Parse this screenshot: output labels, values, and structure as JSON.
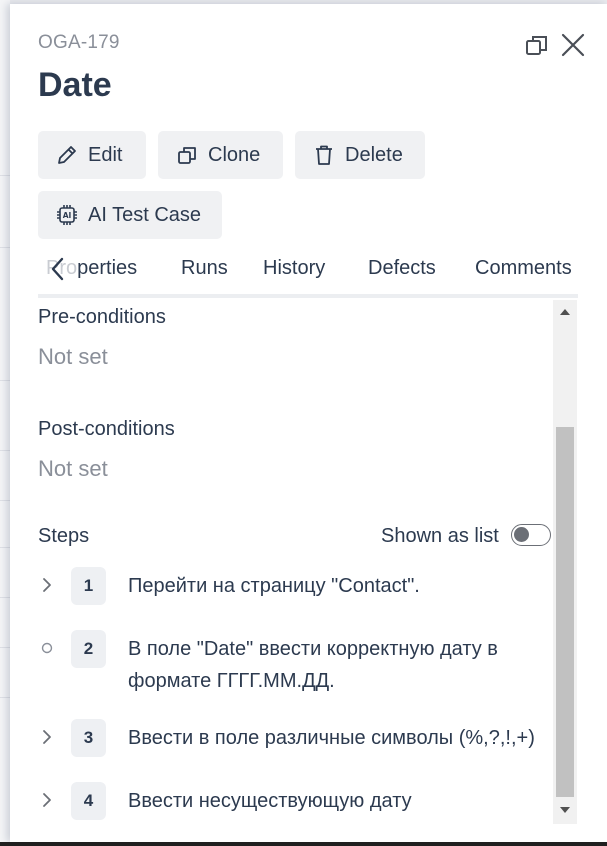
{
  "case": {
    "id": "OGA-179",
    "title": "Date"
  },
  "window_icons": [
    "restore-icon",
    "close-icon"
  ],
  "actions": {
    "edit": "Edit",
    "clone": "Clone",
    "delete": "Delete",
    "ai_test_case": "AI Test Case",
    "ai_icon": "AI"
  },
  "tabs": {
    "properties_faded": "Pro",
    "properties_rest": "perties",
    "runs": "Runs",
    "history": "History",
    "defects": "Defects",
    "comments": "Comments"
  },
  "preconditions": {
    "label": "Pre-conditions",
    "value": "Not set"
  },
  "postconditions": {
    "label": "Post-conditions",
    "value": "Not set"
  },
  "steps": {
    "label": "Steps",
    "toggle_label": "Shown as list",
    "toggle_on": false,
    "items": [
      {
        "number": "1",
        "text": "Перейти на страницу \"Contact\".",
        "expander": "chevron-right-icon"
      },
      {
        "number": "2",
        "text": "В поле \"Date\" ввести корректную дату в формате ГГГГ.ММ.ДД.",
        "expander": "circle-icon"
      },
      {
        "number": "3",
        "text": "Ввести в поле различные символы (%,?,!,+)",
        "expander": "chevron-right-icon"
      },
      {
        "number": "4",
        "text": "Ввести несуществующую дату",
        "expander": "chevron-right-icon"
      }
    ]
  },
  "colors": {
    "text_primary": "#2c3a4f",
    "text_muted": "#8a8f99",
    "button_bg": "#f0f1f3",
    "step_badge_bg": "#eef0f3"
  }
}
